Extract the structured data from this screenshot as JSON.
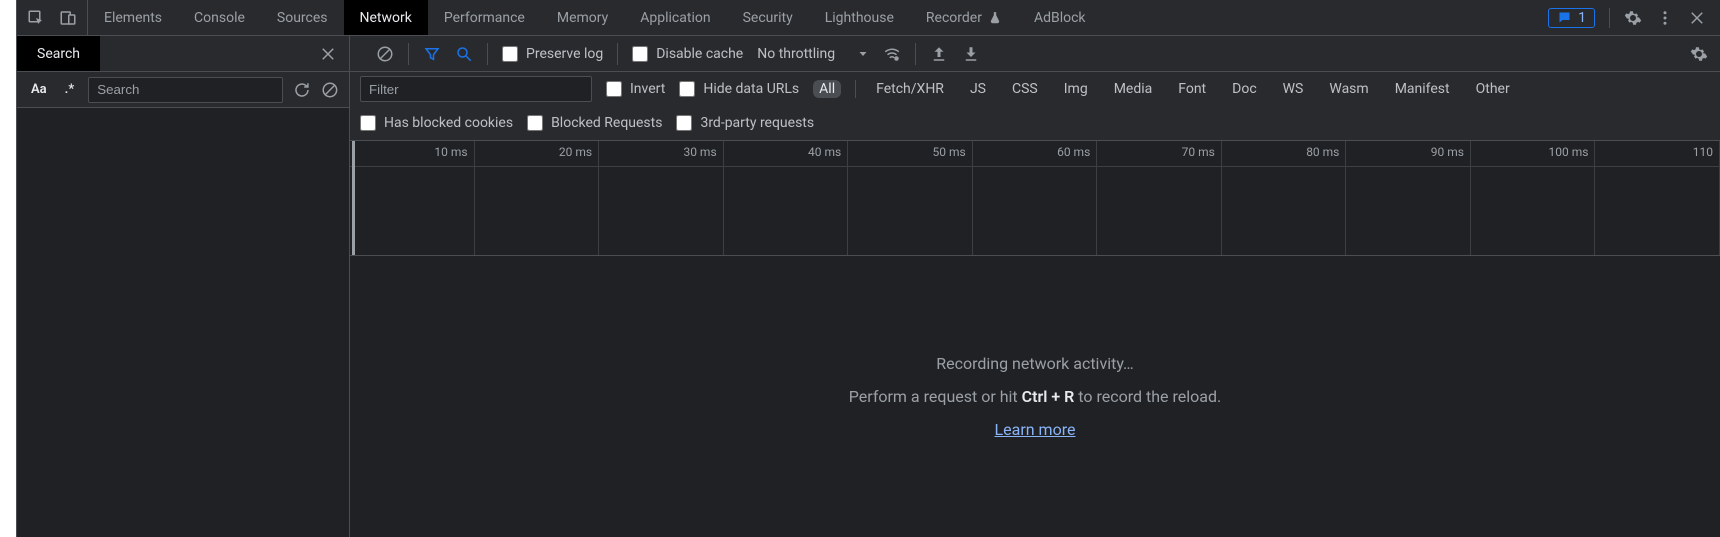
{
  "tabs": {
    "elements": "Elements",
    "console": "Console",
    "sources": "Sources",
    "network": "Network",
    "performance": "Performance",
    "memory": "Memory",
    "application": "Application",
    "security": "Security",
    "lighthouse": "Lighthouse",
    "recorder": "Recorder",
    "adblock": "AdBlock"
  },
  "issues": {
    "count": "1"
  },
  "search": {
    "tab_label": "Search",
    "case_toggle": "Aa",
    "regex_toggle": ".*",
    "placeholder": "Search"
  },
  "toolbar": {
    "preserve_log": "Preserve log",
    "disable_cache": "Disable cache",
    "throttling": "No throttling"
  },
  "filterbar": {
    "filter_placeholder": "Filter",
    "invert": "Invert",
    "hide_data_urls": "Hide data URLs",
    "types": {
      "all": "All",
      "fetchxhr": "Fetch/XHR",
      "js": "JS",
      "css": "CSS",
      "img": "Img",
      "media": "Media",
      "font": "Font",
      "doc": "Doc",
      "ws": "WS",
      "wasm": "Wasm",
      "manifest": "Manifest",
      "other": "Other"
    },
    "blocked_cookies": "Has blocked cookies",
    "blocked_requests": "Blocked Requests",
    "third_party": "3rd-party requests"
  },
  "timeline": {
    "ticks": [
      "10 ms",
      "20 ms",
      "30 ms",
      "40 ms",
      "50 ms",
      "60 ms",
      "70 ms",
      "80 ms",
      "90 ms",
      "100 ms",
      "110"
    ]
  },
  "empty": {
    "title": "Recording network activity…",
    "perform_a": "Perform a request or hit ",
    "shortcut": "Ctrl + R",
    "perform_b": " to record the reload.",
    "link": "Learn more"
  }
}
